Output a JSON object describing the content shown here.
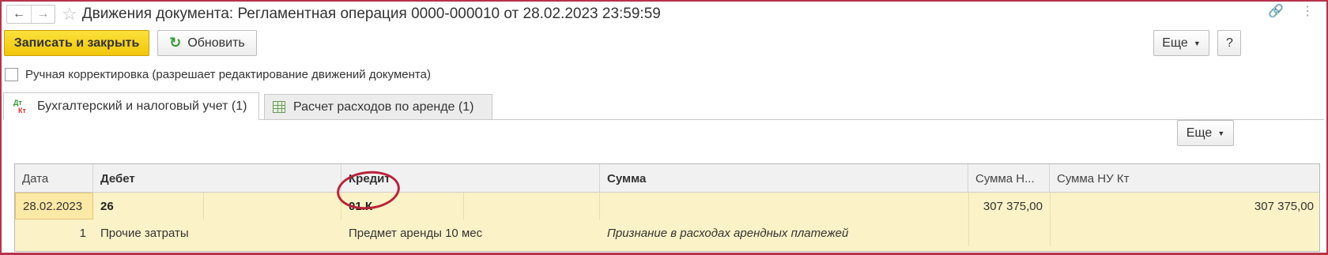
{
  "window": {
    "title": "Движения документа: Регламентная операция 0000-000010 от 28.02.2023 23:59:59",
    "back_icon": "arrow-left",
    "forward_icon": "arrow-right",
    "favorite_icon": "star",
    "link_icon": "link",
    "more_icon": "vertical-dots"
  },
  "toolbar": {
    "save_close_label": "Записать и закрыть",
    "refresh_label": "Обновить",
    "more_label": "Еще",
    "help_label": "?"
  },
  "manual_correction": {
    "label": "Ручная корректировка (разрешает редактирование движений документа)",
    "checked": false
  },
  "tabs": [
    {
      "label": "Бухгалтерский и налоговый учет (1)",
      "active": true,
      "icon": "dt-kt"
    },
    {
      "label": "Расчет расходов по аренде (1)",
      "active": false,
      "icon": "table-grid"
    }
  ],
  "table_toolbar": {
    "more_label": "Еще"
  },
  "table": {
    "columns": [
      "Дата",
      "Дебет",
      "Кредит",
      "Сумма",
      "Сумма Н...",
      "Сумма НУ Кт"
    ],
    "rows": [
      {
        "date": "28.02.2023",
        "line_no": "1",
        "debit": "26",
        "debit_sub": "Прочие затраты",
        "credit": "01.К",
        "credit_sub": "Предмет аренды 10 мес",
        "sum": "",
        "description": "Признание в расходах арендных платежей",
        "sum_nu_dt": "307 375,00",
        "sum_nu_kt": "307 375,00"
      }
    ]
  },
  "colors": {
    "primary_button": "#f2c60b",
    "selected_row": "#fbf2c7",
    "frame_border": "#b8324a",
    "annotation_circle": "#b8233a"
  }
}
